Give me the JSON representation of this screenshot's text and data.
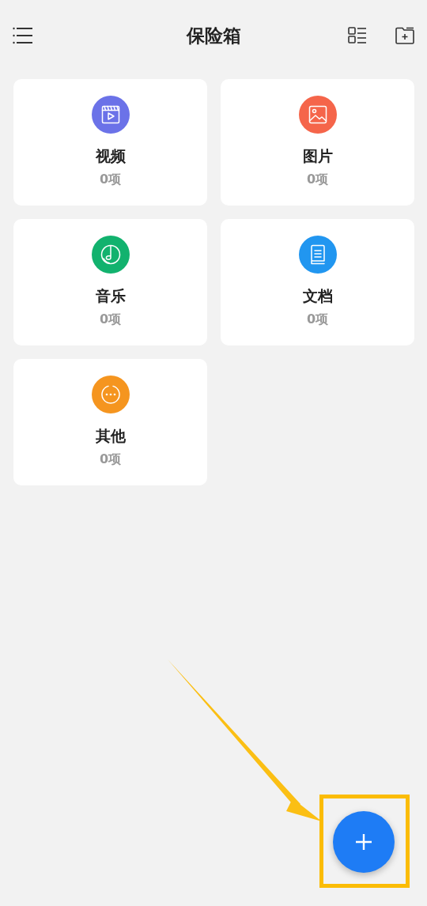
{
  "header": {
    "title": "保险箱"
  },
  "categories": [
    {
      "kind": "video",
      "label": "视频",
      "count": "0项",
      "color": "#6b72e8"
    },
    {
      "kind": "image",
      "label": "图片",
      "count": "0项",
      "color": "#f5654a"
    },
    {
      "kind": "music",
      "label": "音乐",
      "count": "0项",
      "color": "#12b26e"
    },
    {
      "kind": "document",
      "label": "文档",
      "count": "0项",
      "color": "#2196f0"
    },
    {
      "kind": "other",
      "label": "其他",
      "count": "0项",
      "color": "#f5951f"
    }
  ]
}
